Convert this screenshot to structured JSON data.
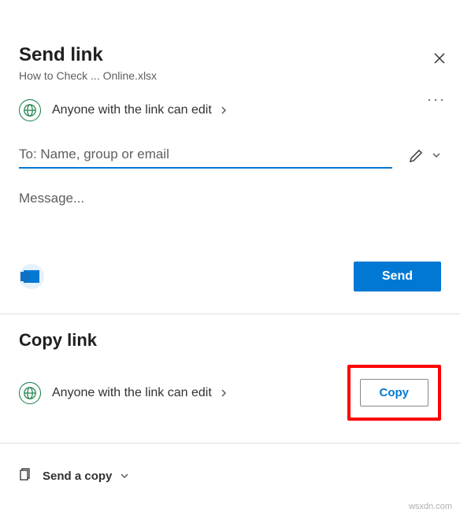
{
  "header": {
    "title": "Send link",
    "filename": "How to Check ... Online.xlsx"
  },
  "permission": {
    "text": "Anyone with the link can edit"
  },
  "to": {
    "placeholder": "To: Name, group or email"
  },
  "message": {
    "placeholder": "Message..."
  },
  "send": {
    "label": "Send"
  },
  "copy_section": {
    "title": "Copy link",
    "permission_text": "Anyone with the link can edit",
    "button_label": "Copy"
  },
  "send_copy": {
    "label": "Send a copy"
  },
  "watermark": "wsxdn.com"
}
